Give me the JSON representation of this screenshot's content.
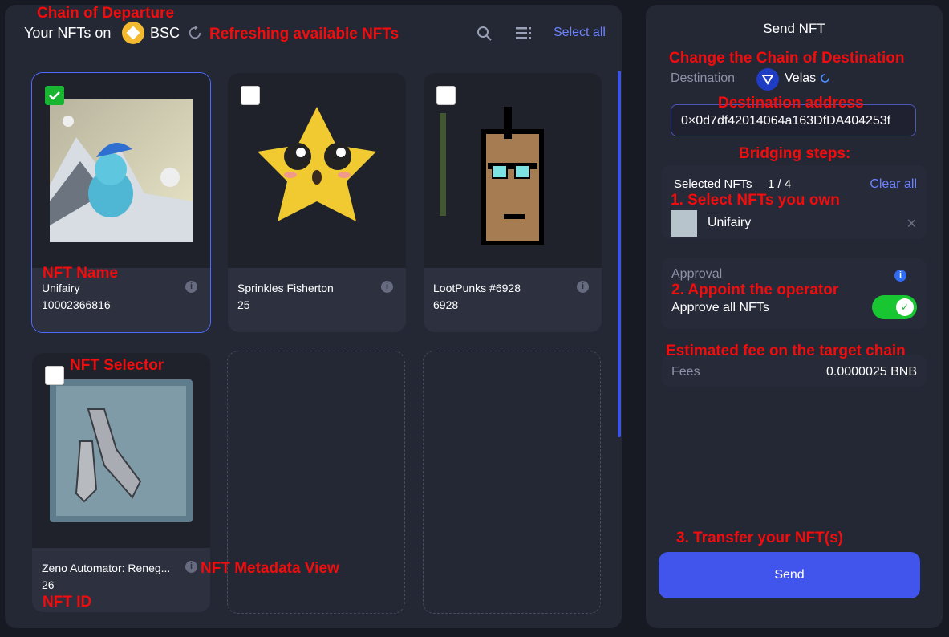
{
  "header": {
    "title": "Your NFTs on",
    "chain": "BSC",
    "select_all": "Select all"
  },
  "cards": [
    {
      "name": "Unifairy",
      "id": "10002366816",
      "selected": true
    },
    {
      "name": "Sprinkles Fisherton",
      "id": "25",
      "selected": false
    },
    {
      "name": "LootPunks #6928",
      "id": "6928",
      "selected": false
    },
    {
      "name": "Zeno Automator: Reneg...",
      "id": "26",
      "selected": false
    }
  ],
  "send_panel": {
    "title": "Send NFT",
    "destination_label": "Destination",
    "destination_chain": "Velas",
    "address": "0×0d7df42014064a163DfDA404253f",
    "selected_label": "Selected NFTs",
    "selected_count": "1 / 4",
    "clear_all": "Clear all",
    "selected_item": "Unifairy",
    "approval_label": "Approval",
    "approve_all": "Approve all NFTs",
    "fees_label": "Fees",
    "fees_value": "0.0000025 BNB",
    "send": "Send"
  },
  "annotations": {
    "chain_departure": "Chain of Departure",
    "refreshing": "Refreshing available NFTs",
    "nft_name": "NFT Name",
    "nft_selector": "NFT Selector",
    "metadata_view": "NFT Metadata View",
    "nft_id": "NFT ID",
    "change_chain": "Change the Chain of Destination",
    "dest_address": "Destination address",
    "bridging": "Bridging steps:",
    "step1": "1. Select NFTs you own",
    "step2": "2. Appoint the operator",
    "fee_target": "Estimated fee on the target chain",
    "step3": "3. Transfer your NFT(s)"
  },
  "colors": {
    "accent": "#4155ec",
    "toggle_on": "#17c630",
    "annotation": "#f10d0d"
  }
}
